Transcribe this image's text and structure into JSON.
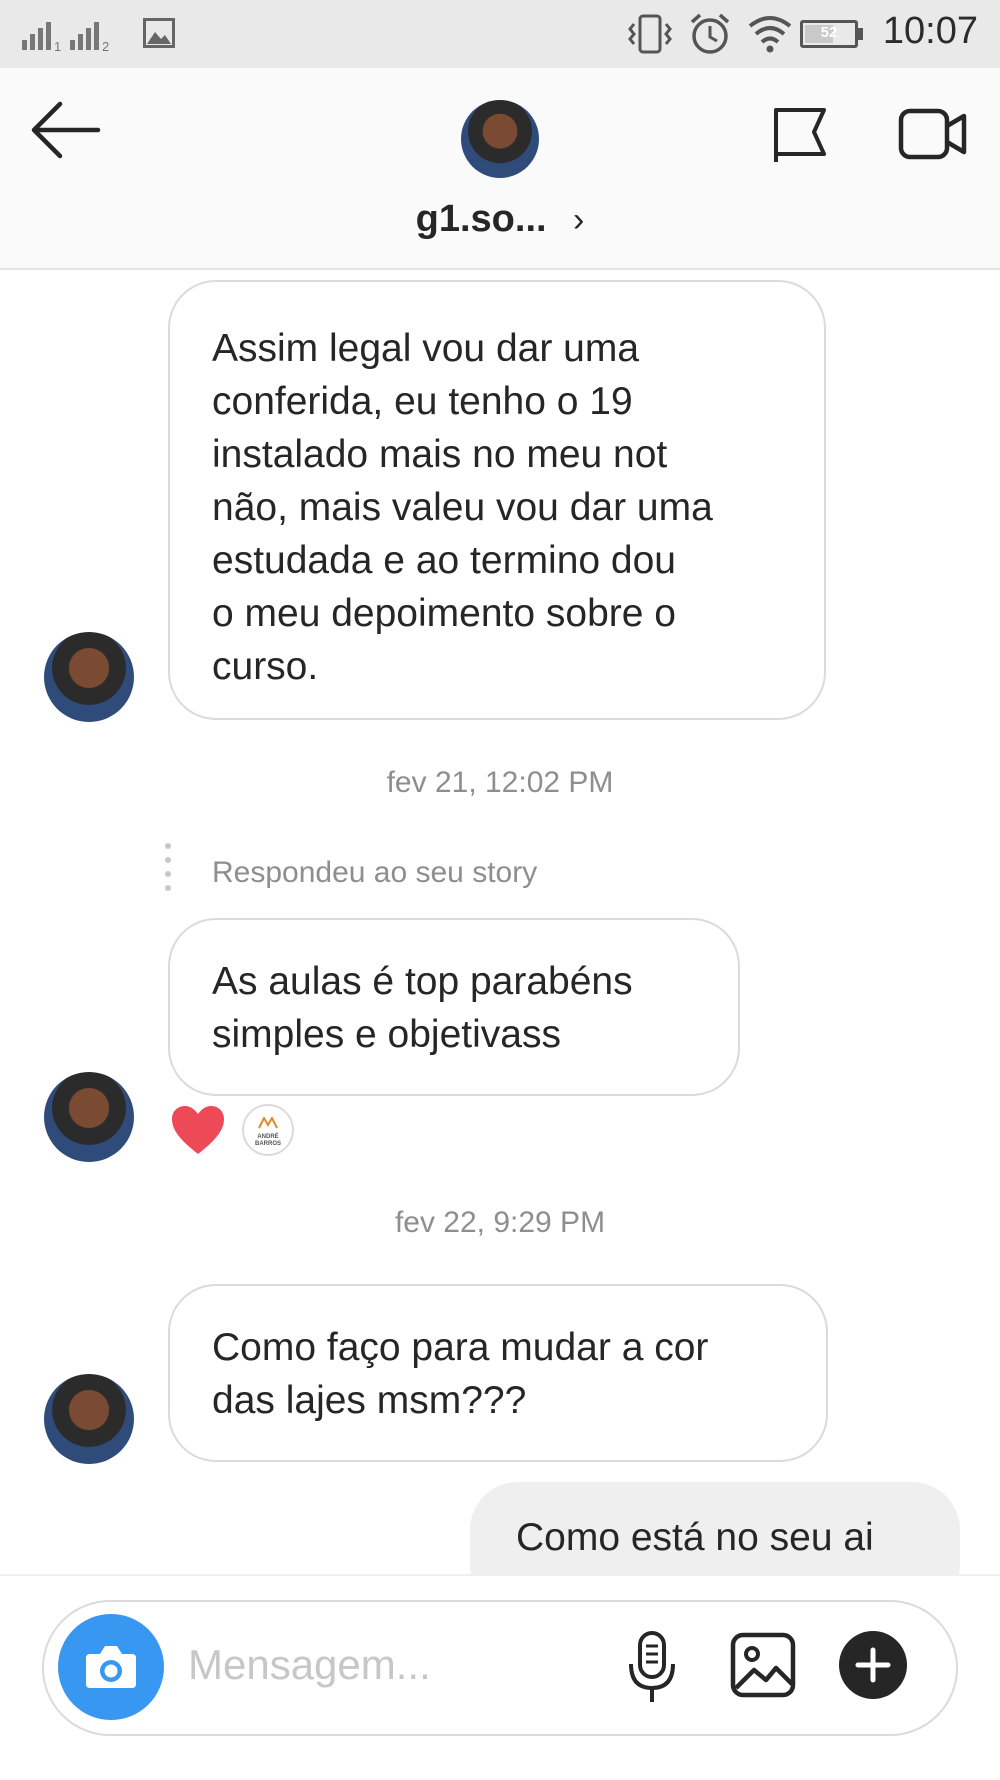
{
  "status_bar": {
    "time": "10:07",
    "battery": "52",
    "signal_labels": [
      "1",
      "2"
    ]
  },
  "header": {
    "username": "g1.so...",
    "chevron": "›",
    "back_icon": "arrow-left-icon",
    "flag_icon": "flag-icon",
    "video_icon": "video-camera-icon"
  },
  "messages": [
    {
      "lines": [
        "Assim legal vou dar uma",
        "conferida, eu tenho o 19",
        "instalado mais no meu not",
        "não, mais valeu vou dar uma",
        "estudada e ao termino dou",
        "o meu depoimento sobre o",
        "curso."
      ]
    },
    {
      "timestamp": "fev 21, 12:02 PM",
      "reply_note": "Respondeu ao seu story",
      "lines": [
        "As aulas é top parabéns",
        "simples e objetivass"
      ],
      "reaction_badge_text": "ANDRÉ BARROS"
    },
    {
      "timestamp": "fev 22, 9:29 PM",
      "lines": [
        "Como faço para mudar a cor",
        "das lajes msm???"
      ]
    }
  ],
  "outgoing": {
    "text": "Como está no seu ai"
  },
  "composer": {
    "placeholder": "Mensagem...",
    "camera_icon": "camera-icon",
    "mic_icon": "microphone-icon",
    "gallery_icon": "image-icon",
    "plus_icon": "plus-icon"
  },
  "colors": {
    "accent": "#3897f0",
    "heart": "#ed4956",
    "bubble_border": "#dbdbdb",
    "outgoing_bg": "#efefef"
  }
}
